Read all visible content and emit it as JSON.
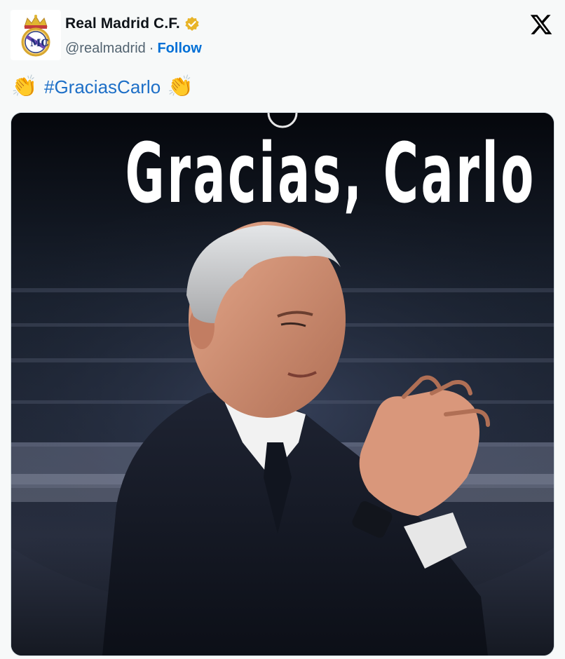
{
  "tweet": {
    "author": {
      "display_name": "Real Madrid C.F.",
      "handle": "@realmadrid",
      "separator": "·",
      "follow_label": "Follow",
      "verified": true,
      "avatar_icon": "real-madrid-crest"
    },
    "text": {
      "emoji_left": "👏",
      "hashtag": "#GraciasCarlo",
      "emoji_right": "👏"
    },
    "media": {
      "headline": "Gracias, Carlo"
    },
    "brand_icon": "x-logo"
  },
  "colors": {
    "link": "#006fd6",
    "hashtag": "#1d6fc7",
    "verified_badge": "#e8b428",
    "background": "#f7f9f9"
  }
}
